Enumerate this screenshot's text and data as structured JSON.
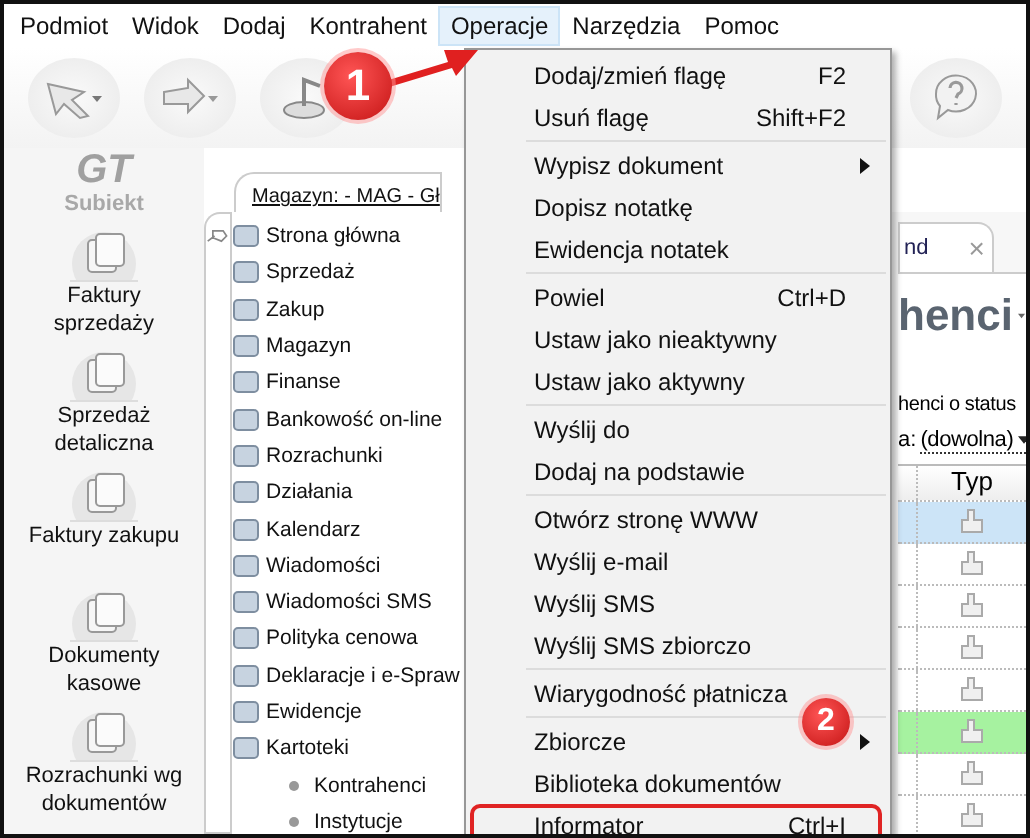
{
  "menubar": [
    {
      "label": "Podmiot",
      "selected": false
    },
    {
      "label": "Widok",
      "selected": false
    },
    {
      "label": "Dodaj",
      "selected": false
    },
    {
      "label": "Kontrahent",
      "selected": false
    },
    {
      "label": "Operacje",
      "selected": true
    },
    {
      "label": "Narzędzia",
      "selected": false
    },
    {
      "label": "Pomoc",
      "selected": false
    }
  ],
  "address": "Magazyn: - MAG - Gł",
  "logo": {
    "mark": "GT",
    "name": "Subiekt"
  },
  "sidebar": {
    "items": [
      {
        "label": "Faktury sprzedaży"
      },
      {
        "label": "Sprzedaż detaliczna"
      },
      {
        "label": "Faktury zakupu"
      },
      {
        "label": "Dokumenty kasowe"
      },
      {
        "label": "Rozrachunki wg dokumentów"
      }
    ]
  },
  "nav_tree": [
    {
      "label": "Strona główna"
    },
    {
      "label": "Sprzedaż"
    },
    {
      "label": "Zakup"
    },
    {
      "label": "Magazyn"
    },
    {
      "label": "Finanse"
    },
    {
      "label": "Bankowość on-line"
    },
    {
      "label": "Rozrachunki"
    },
    {
      "label": "Działania"
    },
    {
      "label": "Kalendarz"
    },
    {
      "label": "Wiadomości"
    },
    {
      "label": "Wiadomości SMS"
    },
    {
      "label": "Polityka cenowa"
    },
    {
      "label": "Deklaracje i e-Spraw"
    },
    {
      "label": "Ewidencje"
    },
    {
      "label": "Kartoteki",
      "children": [
        {
          "label": "Kontrahenci"
        },
        {
          "label": "Instytucje"
        }
      ]
    }
  ],
  "menu": [
    {
      "kind": "item",
      "label": "Dodaj/zmień flagę",
      "shortcut": "F2"
    },
    {
      "kind": "item",
      "label": "Usuń flagę",
      "shortcut": "Shift+F2"
    },
    {
      "kind": "separator"
    },
    {
      "kind": "item",
      "label": "Wypisz dokument",
      "submenu": true
    },
    {
      "kind": "item",
      "label": "Dopisz notatkę"
    },
    {
      "kind": "item",
      "label": "Ewidencja notatek"
    },
    {
      "kind": "separator"
    },
    {
      "kind": "item",
      "label": "Powiel",
      "shortcut": "Ctrl+D"
    },
    {
      "kind": "item",
      "label": "Ustaw jako nieaktywny"
    },
    {
      "kind": "item",
      "label": "Ustaw jako aktywny"
    },
    {
      "kind": "separator"
    },
    {
      "kind": "item",
      "label": "Wyślij do"
    },
    {
      "kind": "item",
      "label": "Dodaj na podstawie"
    },
    {
      "kind": "separator"
    },
    {
      "kind": "item",
      "label": "Otwórz stronę WWW"
    },
    {
      "kind": "item",
      "label": "Wyślij e-mail"
    },
    {
      "kind": "item",
      "label": "Wyślij SMS"
    },
    {
      "kind": "item",
      "label": "Wyślij SMS zbiorczo"
    },
    {
      "kind": "separator"
    },
    {
      "kind": "item",
      "label": "Wiarygodność płatnicza"
    },
    {
      "kind": "separator"
    },
    {
      "kind": "item",
      "label": "Zbiorcze",
      "submenu": true
    },
    {
      "kind": "item",
      "label": "Biblioteka dokumentów"
    },
    {
      "kind": "item",
      "label": "Informator",
      "shortcut": "Ctrl+I",
      "outlined": true
    }
  ],
  "document": {
    "tab": {
      "label": "nd",
      "close": "×"
    },
    "heading": "henci",
    "description": "henci o status",
    "filter": {
      "label": "a:",
      "value": "(dowolna)"
    },
    "table": {
      "columns": [
        "Typ"
      ],
      "rows": [
        {
          "selected": true
        },
        {
          "selected": false
        },
        {
          "selected": false
        },
        {
          "selected": false
        },
        {
          "selected": false
        },
        {
          "selected": false,
          "color": "#a6f2a0"
        },
        {
          "selected": false
        },
        {
          "selected": false
        }
      ]
    }
  },
  "callouts": [
    {
      "number": "1"
    },
    {
      "number": "2"
    }
  ]
}
